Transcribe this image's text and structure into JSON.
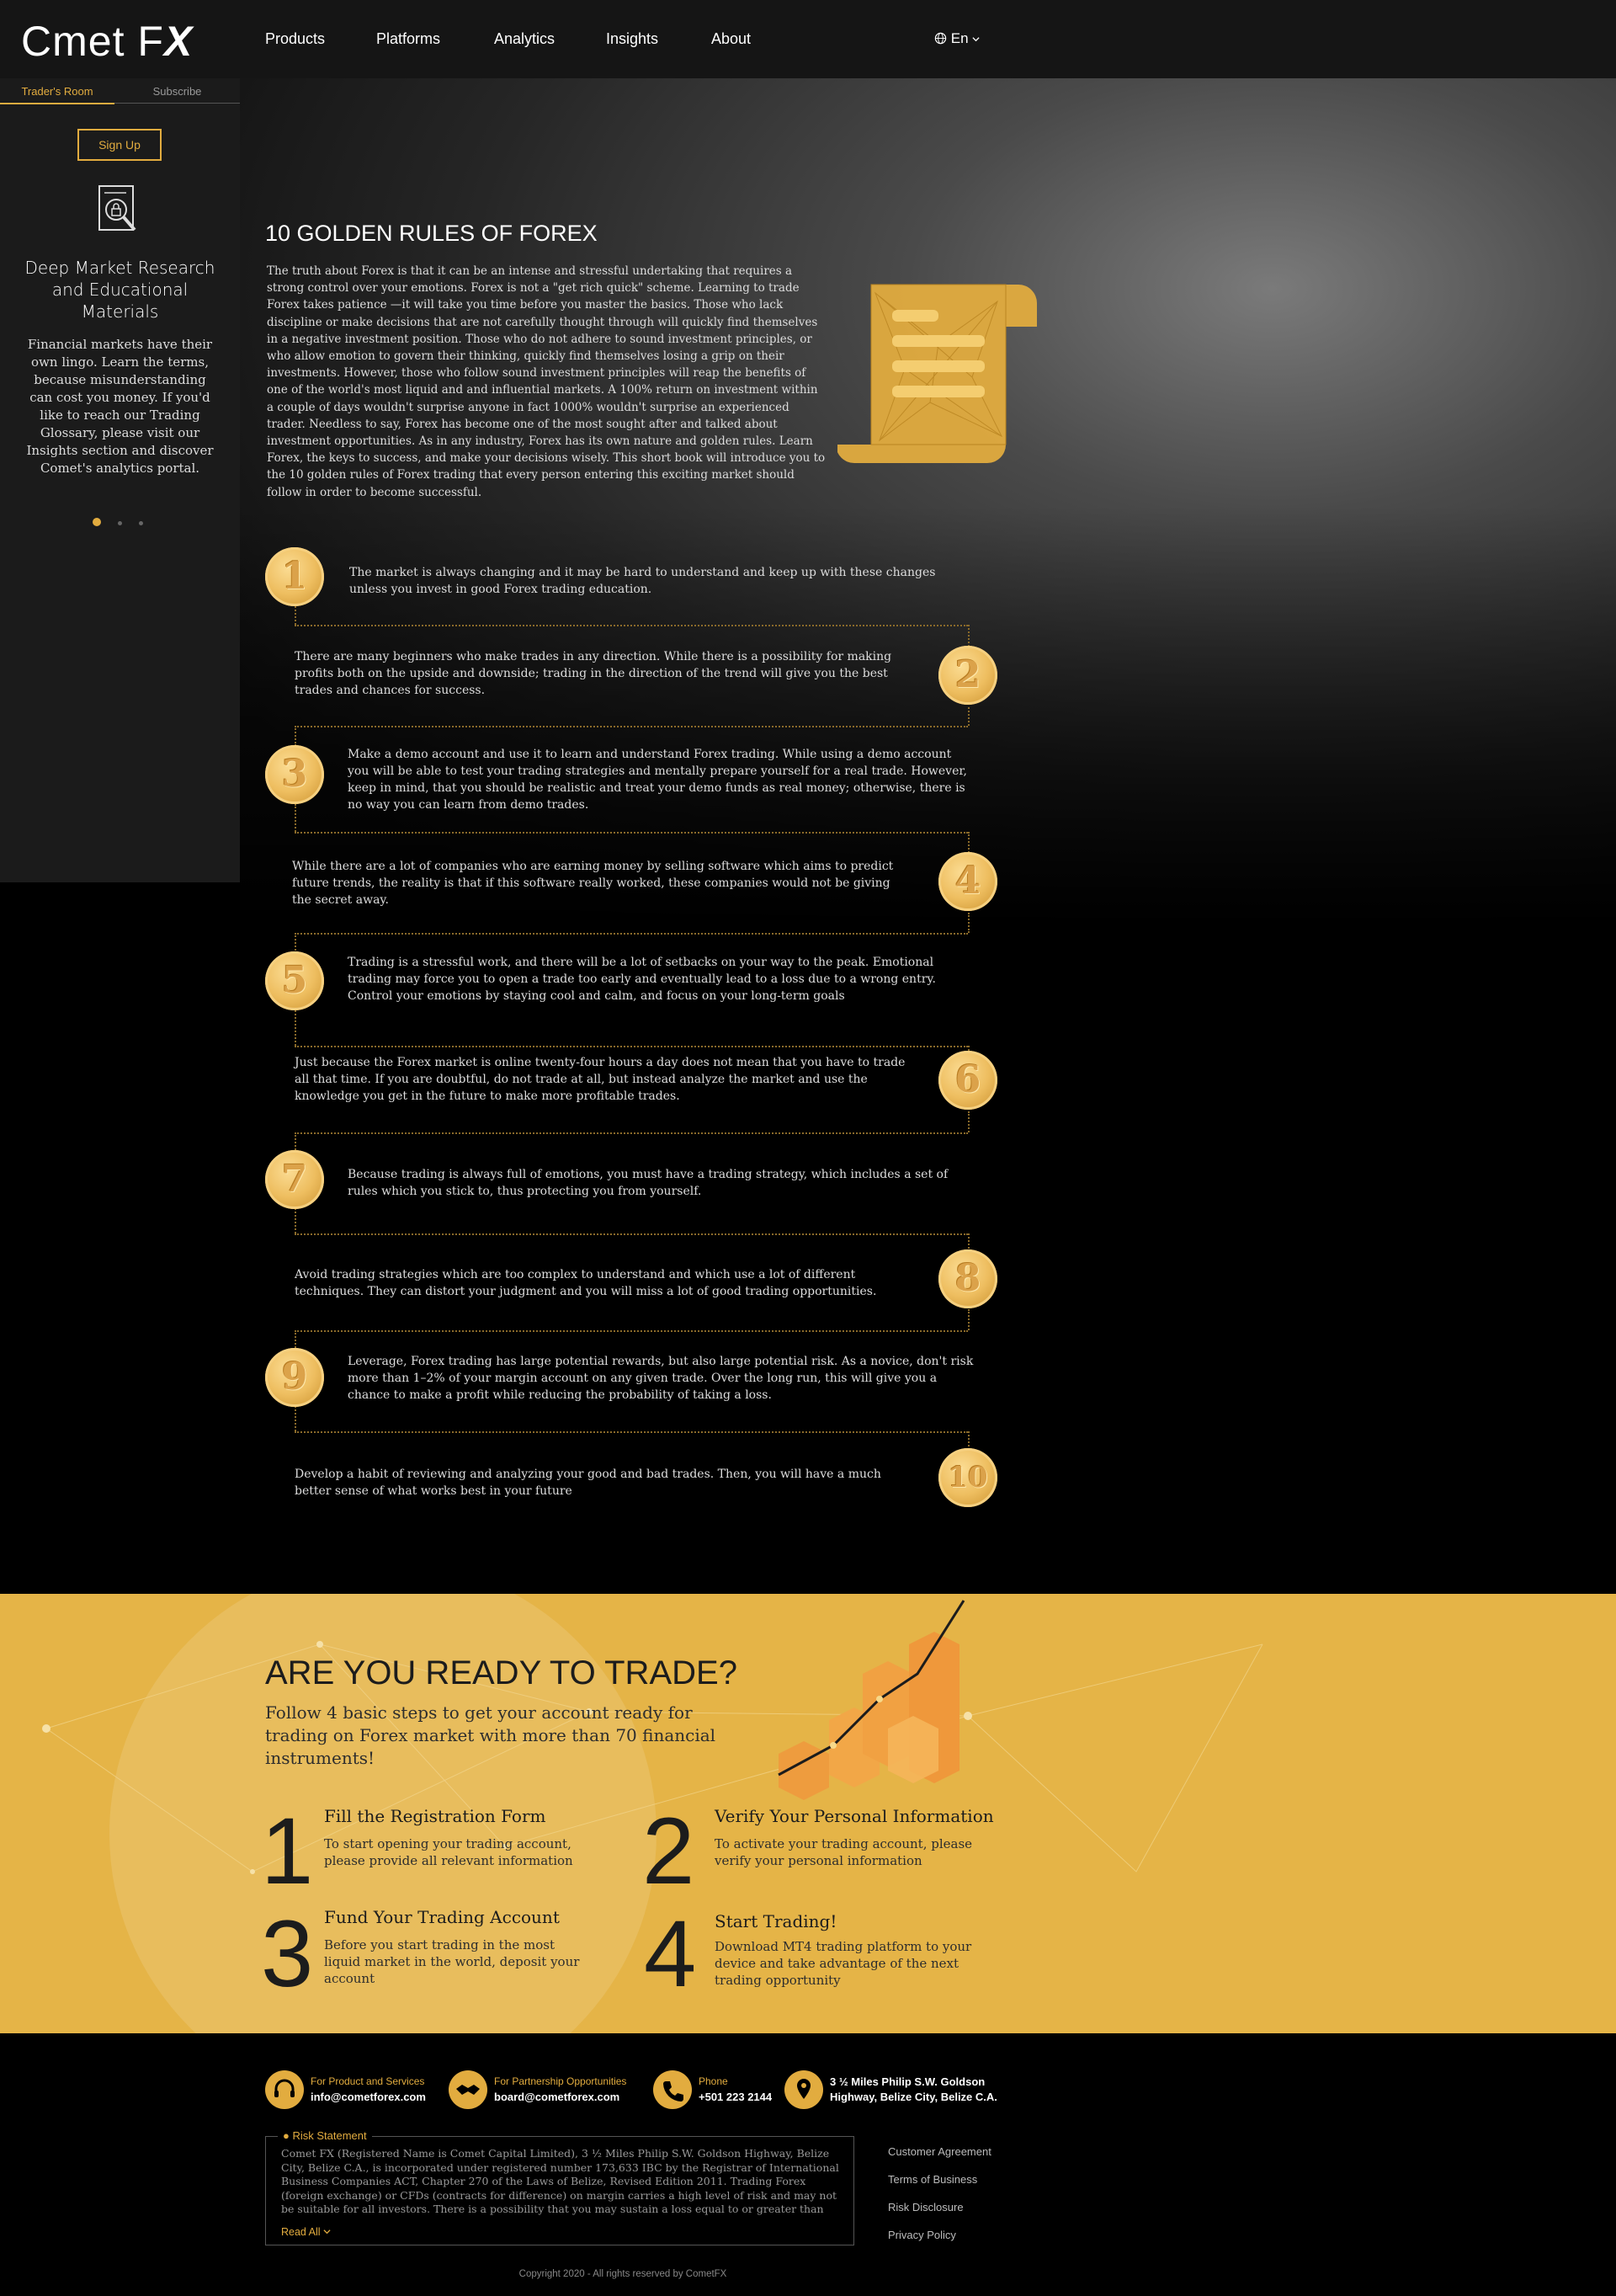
{
  "brand": {
    "logo_main": "C",
    "logo_rest": "met F",
    "logo_x": "X"
  },
  "nav": {
    "items": [
      "Products",
      "Platforms",
      "Analytics",
      "Insights",
      "About"
    ],
    "lang": "En"
  },
  "sidebar": {
    "tabs": [
      "Trader's Room",
      "Subscribe"
    ],
    "signup": "Sign Up",
    "title": "Deep Market Research and Educational Materials",
    "text": "Financial markets have their own lingo. Learn the terms, because misunderstanding can cost you money. If you'd like to reach our Trading Glossary, please visit our Insights section and discover Comet's analytics portal."
  },
  "hero": {
    "title": "10 GOLDEN RULES OF FOREX",
    "intro": "The truth about Forex is that it can be an intense and stressful undertaking that requires a strong control over your emotions. Forex is not a \"get rich quick\" scheme. Learning to trade Forex takes patience —it will take you time before you master the basics. Those who lack discipline or make decisions that are not carefully thought through will quickly find themselves in a negative investment position. Those who do not adhere to sound investment principles, or who allow emotion to govern their thinking, quickly find themselves losing a grip on their investments. However, those who follow sound investment principles will reap the benefits of one of the world's most liquid and and influential markets. A 100% return on investment within a couple of days wouldn't surprise anyone in fact 1000% wouldn't surprise an experienced trader. Needless to say, Forex has become one of the most sought after and talked about investment opportunities. As in any industry, Forex has its own nature and golden rules. Learn Forex, the keys to success, and make your decisions wisely. This short book will introduce you to the 10 golden rules of Forex trading that every person entering this exciting market should follow in order to become successful."
  },
  "rules": [
    {
      "num": "1",
      "text": "The market is always changing and it may be hard to understand and keep up with these changes unless you invest in good Forex trading education."
    },
    {
      "num": "2",
      "text": "There are many beginners who make trades in any direction. While there is a possibility for making profits both on the upside and downside; trading in the direction of the trend will give you the best trades and chances for success."
    },
    {
      "num": "3",
      "text": "Make a demo account and use it to learn and understand Forex trading. While using a demo account you will be able to test your trading strategies and mentally prepare yourself for a real trade. However, keep in mind, that you should be realistic and treat your demo funds as real money; otherwise, there is no way you can learn from demo trades."
    },
    {
      "num": "4",
      "text": "While there are a lot of companies who are earning money by selling software which aims to predict future trends, the reality is that if this software really worked, these companies would not be giving the secret away."
    },
    {
      "num": "5",
      "text": "Trading is a stressful work, and there will be a lot of setbacks on your way to the peak. Emotional trading may force you to open a trade too early and eventually lead to a loss due to a wrong entry. Control your emotions by staying cool and calm, and focus on your long-term goals"
    },
    {
      "num": "6",
      "text": "Just because the Forex market is online twenty-four hours a day does not mean that you have to trade all that time. If you are doubtful, do not trade at all, but instead analyze the market and use the knowledge you get in the future to make more profitable trades."
    },
    {
      "num": "7",
      "text": "Because trading is always full of emotions, you must have a trading strategy, which includes a set of rules which you stick to, thus protecting you from yourself."
    },
    {
      "num": "8",
      "text": "Avoid trading strategies which are too complex to understand and which use a lot of different techniques. They can distort your judgment and you will miss a lot of good trading opportunities."
    },
    {
      "num": "9",
      "text": "Leverage, Forex trading has large potential rewards, but also large potential risk. As a novice, don't risk more than 1–2% of your margin account on any given trade. Over the long run, this will give you a chance to make a profit while reducing the probability of taking a loss."
    },
    {
      "num": "10",
      "text": "Develop a habit of reviewing and analyzing your good and bad trades. Then, you will have a much better sense of what works best in your future"
    }
  ],
  "ready": {
    "title": "ARE YOU READY TO TRADE?",
    "subtitle": "Follow 4 basic steps to get your account ready for trading on Forex market with more than 70 financial instruments!",
    "steps": [
      {
        "num": "1",
        "title": "Fill the Registration Form",
        "text": "To start opening your trading account, please provide all relevant information"
      },
      {
        "num": "2",
        "title": "Verify Your Personal Information",
        "text": "To activate your trading account, please verify your personal information"
      },
      {
        "num": "3",
        "title": "Fund Your Trading Account",
        "text": "Before you start trading in the most liquid market in the world, deposit your account"
      },
      {
        "num": "4",
        "title": "Start Trading!",
        "text": "Download MT4 trading platform to your device and take advantage of the next trading opportunity"
      }
    ]
  },
  "footer": {
    "contacts": [
      {
        "label": "For Product and Services",
        "value": "info@cometforex.com"
      },
      {
        "label": "For Partnership Opportunities",
        "value": "board@cometforex.com"
      },
      {
        "label": "Phone",
        "value": "+501 223 2144"
      },
      {
        "label": "3 ½ Miles Philip S.W. Goldson",
        "value": "Highway, Belize City, Belize C.A."
      }
    ],
    "risk_title": "Risk Statement",
    "risk_text": "Comet FX (Registered Name is Comet Capital Limited), 3 ½ Miles Philip S.W. Goldson Highway, Belize City, Belize C.A., is incorporated under registered number 173,633 IBC by the Registrar of International Business Companies ACT, Chapter 270 of the Laws of Belize, Revised Edition 2011. Trading Forex (foreign exchange) or CFDs (contracts for difference) on margin carries a high level of risk and may not be suitable for all investors. There is a possibility that you may sustain a loss equal to or greater than your entire investment.",
    "read_all": "Read All",
    "links": [
      "Customer Agreement",
      "Terms of Business",
      "Risk Disclosure",
      "Privacy Policy"
    ],
    "copyright": "Copyright 2020 - All rights reserved by CometFX"
  },
  "colors": {
    "gold": "#e2ac3f",
    "banner": "#e5b447",
    "dark": "#151515"
  }
}
